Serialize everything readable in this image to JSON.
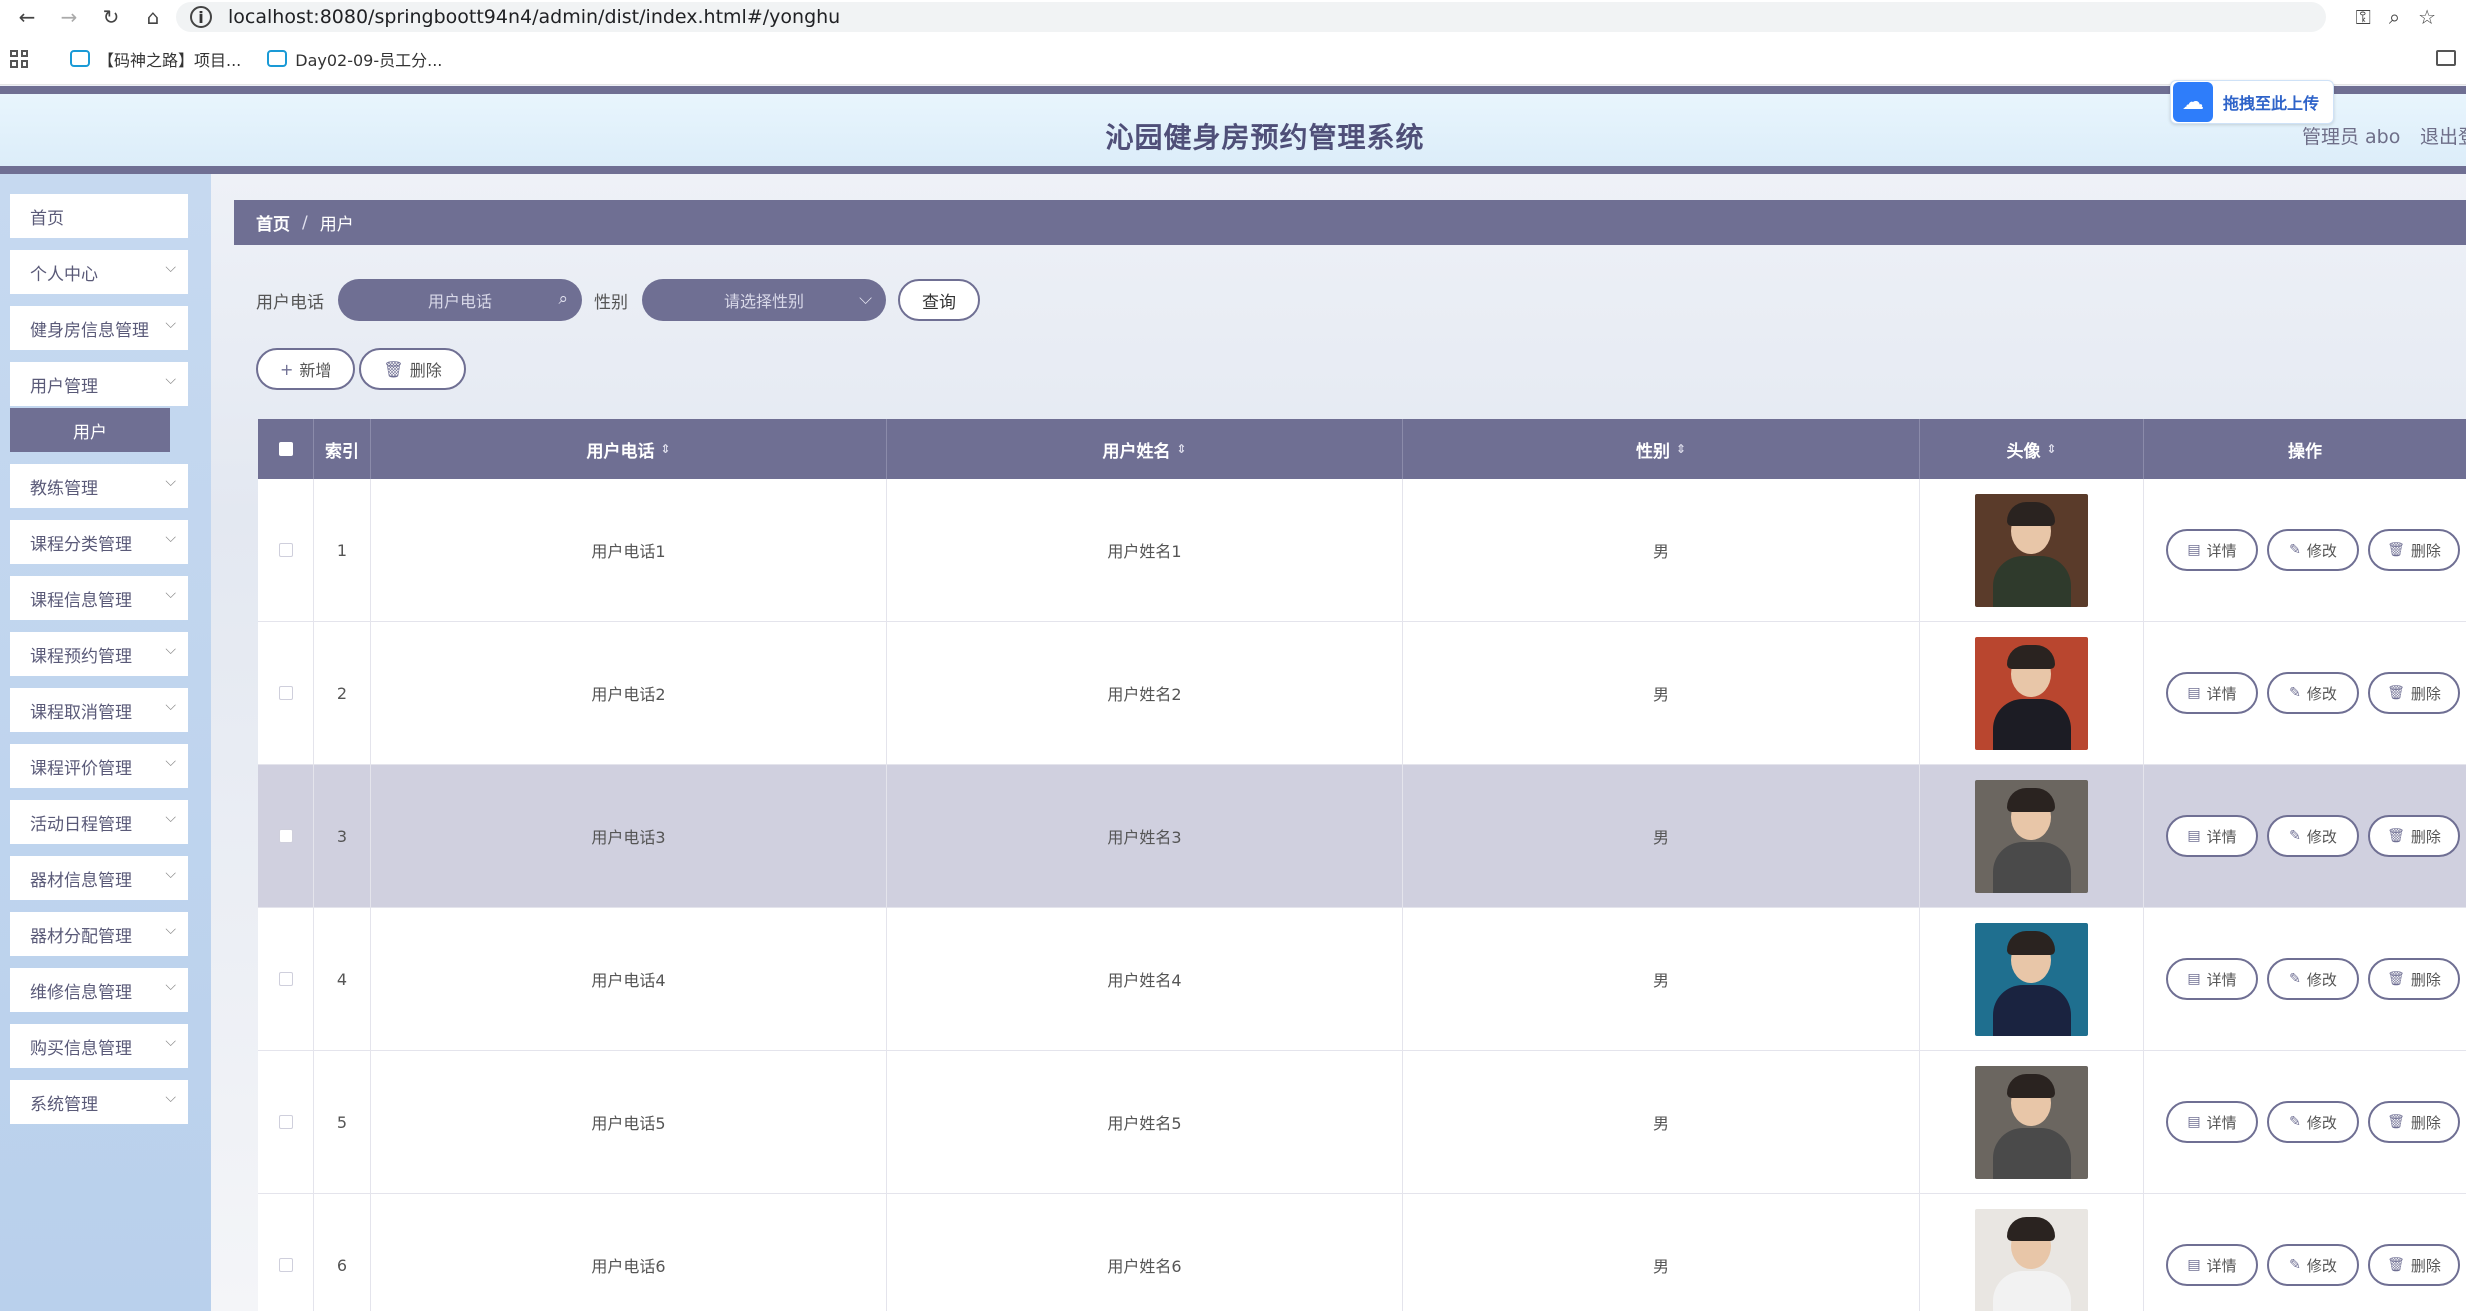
{
  "browser": {
    "url": "localhost:8080/springboott94n4/admin/dist/index.html#/yonghu",
    "bookmarks": [
      "【码神之路】项目...",
      "Day02-09-员工分..."
    ]
  },
  "header": {
    "title": "沁园健身房预约管理系统",
    "user": "管理员 abo",
    "logout": "退出登",
    "upload_badge": "拖拽至此上传"
  },
  "sidebar": {
    "items": [
      {
        "label": "首页",
        "has_chevron": false
      },
      {
        "label": "个人中心",
        "has_chevron": true
      },
      {
        "label": "健身房信息管理",
        "has_chevron": true
      },
      {
        "label": "用户管理",
        "has_chevron": true
      },
      {
        "label": "教练管理",
        "has_chevron": true
      },
      {
        "label": "课程分类管理",
        "has_chevron": true
      },
      {
        "label": "课程信息管理",
        "has_chevron": true
      },
      {
        "label": "课程预约管理",
        "has_chevron": true
      },
      {
        "label": "课程取消管理",
        "has_chevron": true
      },
      {
        "label": "课程评价管理",
        "has_chevron": true
      },
      {
        "label": "活动日程管理",
        "has_chevron": true
      },
      {
        "label": "器材信息管理",
        "has_chevron": true
      },
      {
        "label": "器材分配管理",
        "has_chevron": true
      },
      {
        "label": "维修信息管理",
        "has_chevron": true
      },
      {
        "label": "购买信息管理",
        "has_chevron": true
      },
      {
        "label": "系统管理",
        "has_chevron": true
      }
    ],
    "active_sub": "用户"
  },
  "breadcrumb": {
    "home": "首页",
    "separator": "/",
    "current": "用户"
  },
  "search": {
    "phone_label": "用户电话",
    "phone_placeholder": "用户电话",
    "gender_label": "性别",
    "gender_placeholder": "请选择性别",
    "query_button": "查询"
  },
  "actions": {
    "add": "新增",
    "delete": "删除"
  },
  "table": {
    "columns": [
      "索引",
      "用户电话",
      "用户姓名",
      "性别",
      "头像",
      "操作"
    ],
    "rows": [
      {
        "index": "1",
        "phone": "用户电话1",
        "name": "用户姓名1",
        "gender": "男"
      },
      {
        "index": "2",
        "phone": "用户电话2",
        "name": "用户姓名2",
        "gender": "男"
      },
      {
        "index": "3",
        "phone": "用户电话3",
        "name": "用户姓名3",
        "gender": "男"
      },
      {
        "index": "4",
        "phone": "用户电话4",
        "name": "用户姓名4",
        "gender": "男"
      },
      {
        "index": "5",
        "phone": "用户电话5",
        "name": "用户姓名5",
        "gender": "男"
      },
      {
        "index": "6",
        "phone": "用户电话6",
        "name": "用户姓名6",
        "gender": "男"
      }
    ],
    "row_actions": {
      "detail": "详情",
      "edit": "修改",
      "delete": "删除"
    },
    "highlighted_row": 3
  },
  "colors": {
    "accent": "#6f6f93",
    "header_bg": "#e8f5fd",
    "sidebar_bg": "#c6d9f0",
    "avatar_backgrounds": [
      "#5a3b2a",
      "#b9462f",
      "#6b6660",
      "#1f6f8f",
      "#6b6660",
      "#e9e6e2"
    ],
    "avatar_clothes": [
      "#2f3a2c",
      "#1c1c24",
      "#4a4a4a",
      "#1a2340",
      "#4a4a4a",
      "#f2f2f2"
    ]
  }
}
